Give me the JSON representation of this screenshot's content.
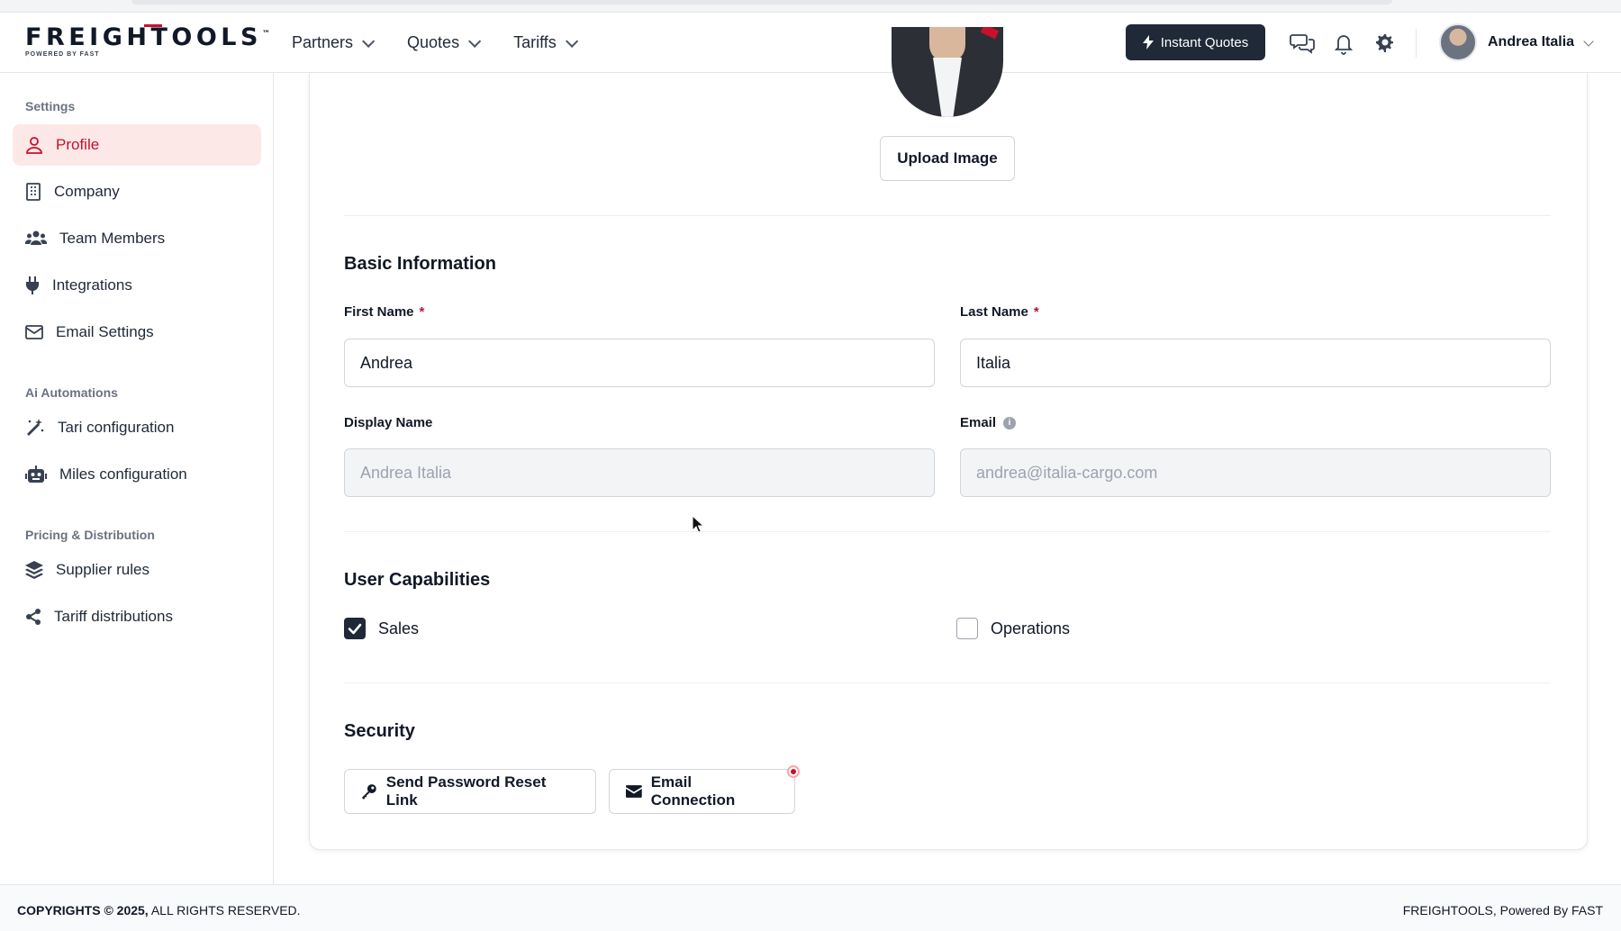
{
  "header": {
    "logo_text": "FREIGHTOOLS",
    "logo_tm": "™",
    "logo_sub": "POWERED BY FAST",
    "nav": [
      {
        "label": "Partners"
      },
      {
        "label": "Quotes"
      },
      {
        "label": "Tariffs"
      }
    ],
    "instant_quotes_label": "Instant Quotes",
    "user_name": "Andrea Italia"
  },
  "sidebar": {
    "sections": [
      {
        "title": "Settings",
        "items": [
          {
            "label": "Profile",
            "icon": "user-icon",
            "active": true
          },
          {
            "label": "Company",
            "icon": "building-icon"
          },
          {
            "label": "Team Members",
            "icon": "users-icon"
          },
          {
            "label": "Integrations",
            "icon": "plug-icon"
          },
          {
            "label": "Email Settings",
            "icon": "envelope-icon"
          }
        ]
      },
      {
        "title": "Ai Automations",
        "items": [
          {
            "label": "Tari configuration",
            "icon": "magic-wand-icon"
          },
          {
            "label": "Miles configuration",
            "icon": "robot-icon"
          }
        ]
      },
      {
        "title": "Pricing & Distribution",
        "items": [
          {
            "label": "Supplier rules",
            "icon": "layers-icon"
          },
          {
            "label": "Tariff distributions",
            "icon": "share-icon"
          }
        ]
      }
    ]
  },
  "profile": {
    "upload_label": "Upload Image",
    "basic_info_title": "Basic Information",
    "first_name_label": "First Name",
    "first_name_value": "Andrea",
    "last_name_label": "Last Name",
    "last_name_value": "Italia",
    "required_mark": "*",
    "display_name_label": "Display Name",
    "display_name_value": "Andrea Italia",
    "email_label": "Email",
    "email_value": "andrea@italia-cargo.com",
    "capabilities_title": "User Capabilities",
    "capabilities": [
      {
        "label": "Sales",
        "checked": true
      },
      {
        "label": "Operations",
        "checked": false
      }
    ],
    "security_title": "Security",
    "reset_link_label": "Send Password Reset Link",
    "email_connection_label": "Email Connection"
  },
  "footer": {
    "copyright_bold": "COPYRIGHTS © 2025,",
    "copyright_rest": " ALL RIGHTS RESERVED.",
    "powered": "FREIGHTOOLS, Powered By FAST"
  },
  "colors": {
    "brand_red": "#c8102e",
    "dark": "#1f2937",
    "active_bg": "#fde8e8"
  }
}
